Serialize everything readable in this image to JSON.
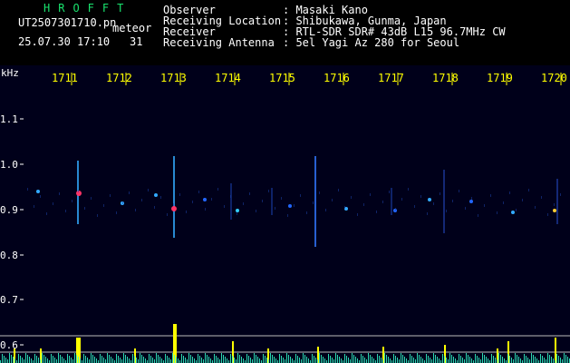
{
  "header": {
    "app_title": "HROFFT",
    "file_name": "UT2507301710.pn",
    "mode_label": "meteor",
    "datetime": "25.07.30 17:10",
    "count": "31",
    "fields": [
      {
        "key": "Observer",
        "value": ": Masaki Kano"
      },
      {
        "key": "Receiving Location",
        "value": ": Shibukawa, Gunma, Japan"
      },
      {
        "key": "Receiver",
        "value": ": RTL-SDR SDR# 43dB L15 96.7MHz CW"
      },
      {
        "key": "Receiving Antenna",
        "value": ": 5el Yagi Az 280 for Seoul"
      }
    ]
  },
  "spectrogram": {
    "y_unit": "kHz",
    "y_ticks": [
      "1.1",
      "1.0",
      "0.9",
      "0.8",
      "0.7",
      "0.6"
    ],
    "time_labels": [
      "1711",
      "1712",
      "1713",
      "1714",
      "1715",
      "1716",
      "1717",
      "1718",
      "1719",
      "1720"
    ],
    "colors": {
      "background": "#00001a",
      "text": "#ffffff",
      "title": "#19e36e",
      "tick": "#ffff00",
      "level": "#ffff00",
      "noise": "#33ffcc"
    }
  }
}
